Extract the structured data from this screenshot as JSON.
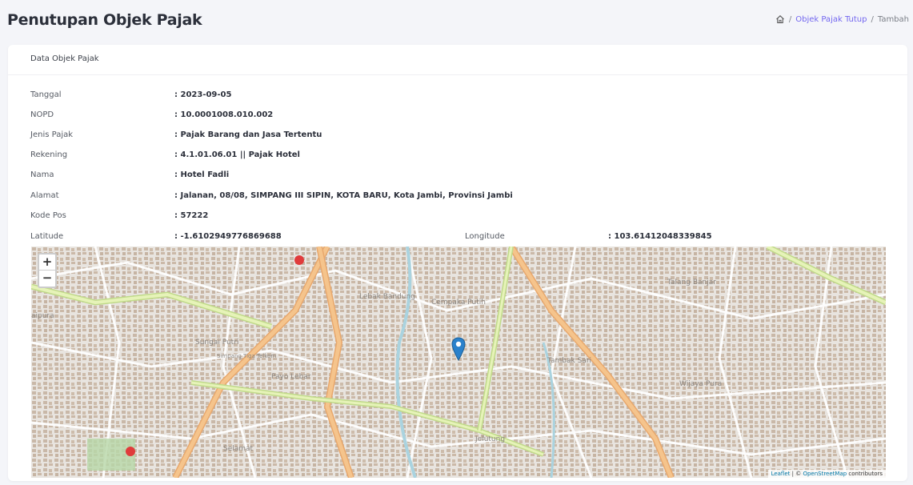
{
  "header": {
    "title": "Penutupan Objek Pajak",
    "breadcrumb": {
      "sep1": "/",
      "link": "Objek Pajak Tutup",
      "sep2": "/",
      "current": "Tambah"
    }
  },
  "card": {
    "title": "Data Objek Pajak",
    "fields": [
      {
        "label": "Tanggal",
        "value": ": 2023-09-05"
      },
      {
        "label": "NOPD",
        "value": ": 10.0001008.010.002"
      },
      {
        "label": "Jenis Pajak",
        "value": ": Pajak Barang dan Jasa Tertentu"
      },
      {
        "label": "Rekening",
        "value": ": 4.1.01.06.01 || Pajak Hotel"
      },
      {
        "label": "Nama",
        "value": ": Hotel Fadli"
      },
      {
        "label": "Alamat",
        "value": ": Jalanan, 08/08, SIMPANG III SIPIN, KOTA BARU, Kota Jambi, Provinsi Jambi"
      },
      {
        "label": "Kode Pos",
        "value": ": 57222"
      }
    ],
    "latitude": {
      "label": "Latitude",
      "value": ": -1.6102949776869688"
    },
    "longitude": {
      "label": "Longitude",
      "value": ": 103.61412048339845"
    }
  },
  "map": {
    "zoom_in": "+",
    "zoom_out": "−",
    "attribution": {
      "leaflet": "Leaflet",
      "sep": " | © ",
      "osm": "OpenStreetMap",
      "rest": " contributors"
    },
    "places": [
      "Lebak Bandung",
      "Cempaka Putih",
      "Talang Banjar",
      "Sungai Putri",
      "Payo Lebar",
      "Tambak Sari",
      "Wijaya Pura",
      "Selamat",
      "Jelutung",
      "aipura",
      "Simpang Tiga Telkom"
    ],
    "marker_color": "#2a81cb"
  }
}
